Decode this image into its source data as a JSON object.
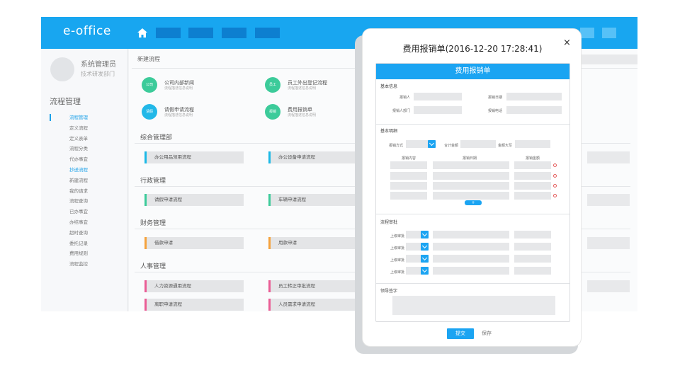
{
  "app": {
    "logo": "e-office",
    "user": {
      "name": "系统管理员",
      "dept": "技术研发部门"
    },
    "sidebar": {
      "title": "流程管理",
      "items": [
        "流程管理",
        "定义流程",
        "定义表单",
        "流程分类",
        "代办事宜",
        "抄送流程",
        "新建流程",
        "我的请求",
        "流程查询",
        "已办事宜",
        "办结事宜",
        "超时查询",
        "委托记录",
        "费用规则",
        "流程监控"
      ]
    },
    "breadcrumb": "新建流程",
    "quick_flows": [
      {
        "badge": "公司",
        "name": "公司内部新闻",
        "sub": "流程描述信息说明",
        "color": "#3ccb9a"
      },
      {
        "badge": "员工",
        "name": "员工外出登记流程",
        "sub": "流程描述信息说明",
        "color": "#3ccb9a"
      },
      {
        "badge": "请假",
        "name": "请假申请流程",
        "sub": "流程描述信息说明",
        "color": "#22b8e8"
      },
      {
        "badge": "报销",
        "name": "费用报销单",
        "sub": "流程描述信息说明",
        "color": "#3ccb9a"
      }
    ],
    "sections": [
      {
        "title": "综合管理部",
        "items": [
          {
            "label": "办公用品领用流程",
            "color": "#1bb8e6"
          },
          {
            "label": "办公设备申请流程",
            "color": "#1bb8e6"
          }
        ]
      },
      {
        "title": "行政管理",
        "items": [
          {
            "label": "请假申请流程",
            "color": "#3ccb9a"
          },
          {
            "label": "车辆申请流程",
            "color": "#3ccb9a"
          }
        ]
      },
      {
        "title": "财务管理",
        "items": [
          {
            "label": "借款申请",
            "color": "#f5a23c"
          },
          {
            "label": "用款申请",
            "color": "#f5a23c"
          }
        ]
      },
      {
        "title": "人事管理",
        "items": [
          {
            "label": "人力资源通用流程",
            "color": "#ea5d95"
          },
          {
            "label": "员工转正审批流程",
            "color": "#ea5d95"
          },
          {
            "label": "离职申请流程",
            "color": "#ea5d95"
          },
          {
            "label": "人员需求申请流程",
            "color": "#ea5d95"
          }
        ]
      }
    ]
  },
  "modal": {
    "title": "费用报销单(2016-12-20 17:28:41)",
    "close": "×",
    "form_header": "费用报销单",
    "basic_info": {
      "title": "基本信息",
      "fields": [
        "报销人",
        "报销日期",
        "报销人部门",
        "报销电话"
      ]
    },
    "details": {
      "title": "基本明细",
      "fields": [
        "报销方式",
        "合计金额",
        "金额大写"
      ],
      "columns": [
        "报销内容",
        "报销日期",
        "报销金额"
      ],
      "add_label": "+"
    },
    "approval": {
      "title": "流程审批",
      "rows": [
        "上级审批",
        "上级审批",
        "上级审批",
        "上级审批"
      ]
    },
    "signature": {
      "title": "领导签字"
    },
    "submit": "提交",
    "save": "保存"
  }
}
